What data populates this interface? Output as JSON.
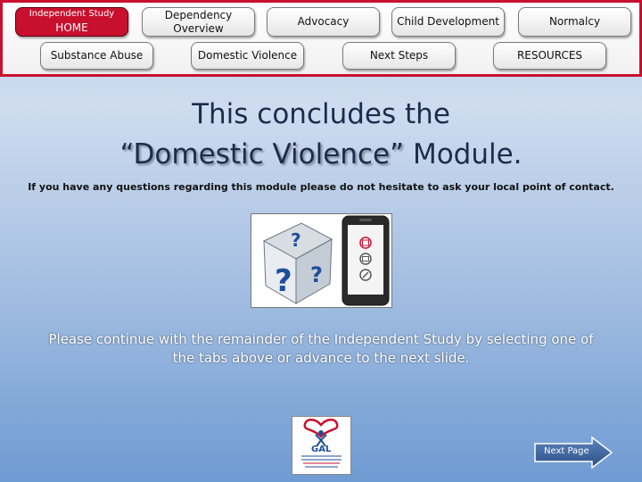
{
  "nav": {
    "home": {
      "line1": "Independent Study",
      "line2": "HOME"
    },
    "dependency_overview": "Dependency Overview",
    "advocacy": "Advocacy",
    "child_development": "Child Development",
    "normalcy": "Normalcy",
    "substance_abuse": "Substance Abuse",
    "domestic_violence": "Domestic Violence",
    "next_steps": "Next Steps",
    "resources": "RESOURCES"
  },
  "main": {
    "headline_line1": "This concludes the",
    "headline_quote": "“Domestic Violence”",
    "headline_module": " Module.",
    "note": "If you have any questions regarding this module please do not hesitate to ask your local point of contact.",
    "continue_text": "Please continue with the remainder of the Independent Study by selecting one of the tabs above or advance to the next slide."
  },
  "logo": {
    "text": "GAL"
  },
  "next_button": {
    "label": "Next Page"
  },
  "colors": {
    "accent": "#c8102e",
    "title": "#1e2b4d"
  }
}
